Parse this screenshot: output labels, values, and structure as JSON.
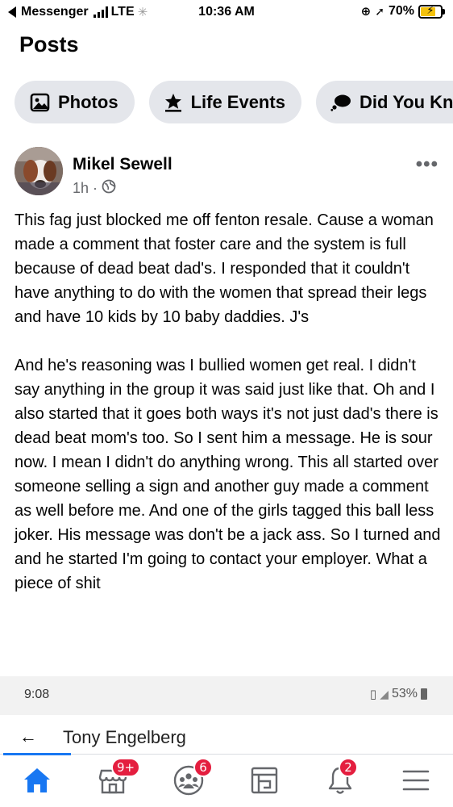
{
  "status_bar": {
    "back_app": "Messenger",
    "network": "LTE",
    "time": "10:36 AM",
    "battery": "70%"
  },
  "header": {
    "title": "Posts"
  },
  "chips": [
    {
      "label": "Photos",
      "icon": "photos-icon"
    },
    {
      "label": "Life Events",
      "icon": "life-events-icon"
    },
    {
      "label": "Did You Kno",
      "icon": "did-you-know-icon"
    }
  ],
  "post": {
    "author": "Mikel Sewell",
    "time_ago": "1h",
    "dot": "·",
    "more": "•••",
    "paragraphs": [
      "This fag just blocked me off fenton resale. Cause a woman made a comment that foster care and the system is full because of dead beat dad's. I responded that it couldn't have anything to do with the women that spread their  legs and have 10 kids by 10 baby daddies. J's",
      "And he's reasoning was I bullied women get real. I didn't say anything in the group it was said just like that. Oh and I also started that it goes both ways it's not just dad's there is dead beat mom's too. So I sent him a message. He is sour now. I mean I didn't do anything wrong. This all started over someone selling a sign and another guy made a comment as well before me. And one of the girls tagged this ball less joker. His message was don't be a jack ass. So I turned and and he started I'm going to contact your employer. What a piece of shit"
    ]
  },
  "embedded": {
    "time": "9:08",
    "battery": "53%",
    "back_arrow": "←",
    "contact_name": "Tony Engelberg"
  },
  "tabbar": {
    "active_color": "#1877f2",
    "badge_color": "#e41e3f",
    "marketplace_badge": "9+",
    "groups_badge": "6",
    "notifications_badge": "2"
  }
}
